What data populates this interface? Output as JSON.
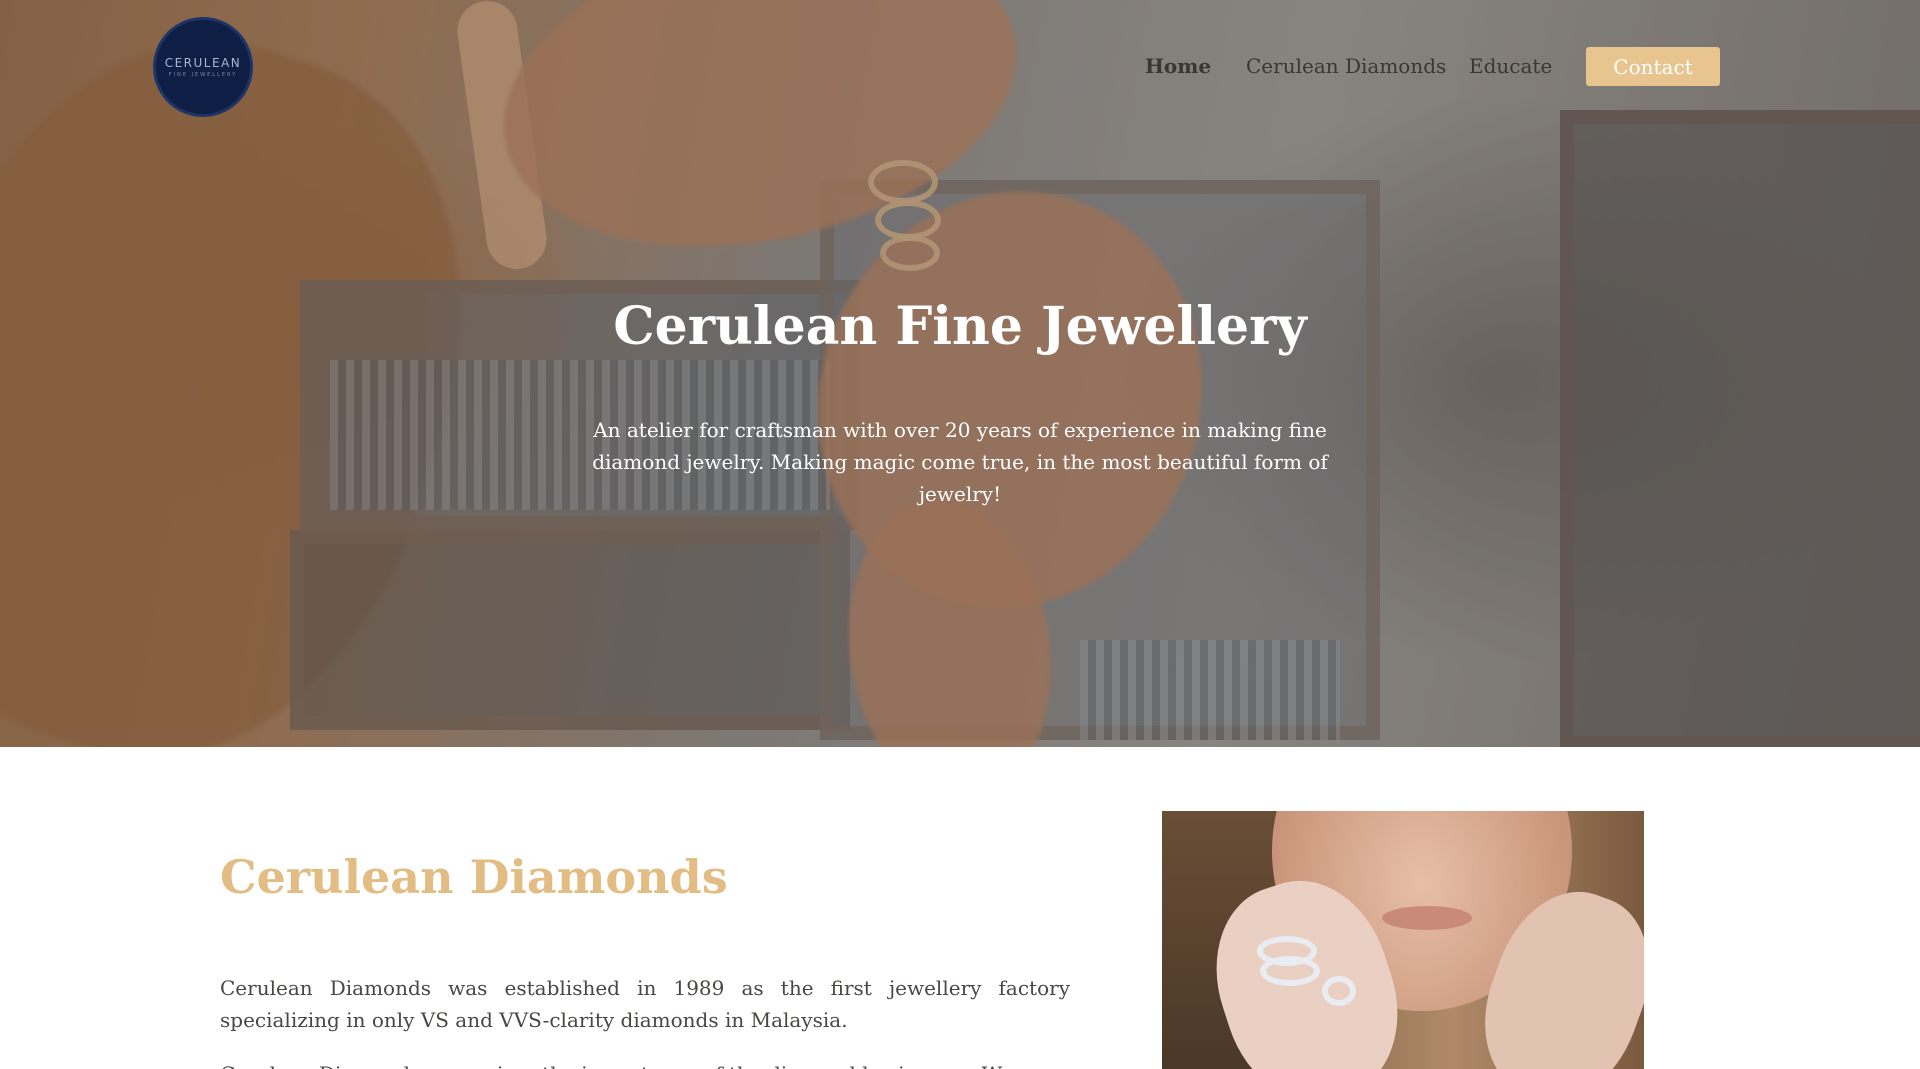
{
  "nav": {
    "logo_text": "CERULEAN",
    "logo_subtext": "FINE JEWELLERY",
    "items": [
      {
        "label": "Home"
      },
      {
        "label": "Cerulean Diamonds"
      },
      {
        "label": "Educate"
      }
    ],
    "contact_label": "Contact"
  },
  "hero": {
    "title": "Cerulean Fine Jewellery",
    "subtitle": "An atelier for craftsman with over 20 years of experience in making fine diamond jewelry. Making magic come true, in the most beautiful form of jewelry!"
  },
  "about": {
    "title": "Cerulean Diamonds",
    "paragraph1": "Cerulean Diamonds was established in 1989 as the first jewellery factory specializing in only VS and VVS-clarity diamonds in Malaysia.",
    "paragraph2": "Cerulean Diamonds recognises the importance of the diamond business ... We"
  },
  "colors": {
    "accent": "#e8c48e",
    "heading_gold": "#e2bc83",
    "logo_navy": "#0e1e44"
  }
}
